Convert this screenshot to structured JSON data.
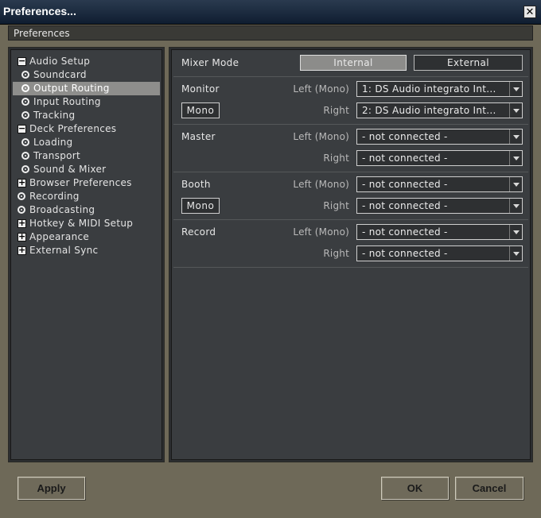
{
  "window": {
    "title": "Preferences...",
    "close_glyph": "✕"
  },
  "header": {
    "title": "Preferences"
  },
  "nav": {
    "items": [
      {
        "label": "Audio Setup",
        "icon": "minus-box",
        "level": 0,
        "selected": false
      },
      {
        "label": "Soundcard",
        "icon": "radio",
        "level": 1,
        "selected": false
      },
      {
        "label": "Output Routing",
        "icon": "radio",
        "level": 1,
        "selected": true
      },
      {
        "label": "Input Routing",
        "icon": "radio",
        "level": 1,
        "selected": false
      },
      {
        "label": "Tracking",
        "icon": "radio",
        "level": 1,
        "selected": false
      },
      {
        "label": "Deck Preferences",
        "icon": "minus-box",
        "level": 0,
        "selected": false
      },
      {
        "label": "Loading",
        "icon": "radio",
        "level": 1,
        "selected": false
      },
      {
        "label": "Transport",
        "icon": "radio",
        "level": 1,
        "selected": false
      },
      {
        "label": "Sound & Mixer",
        "icon": "radio",
        "level": 1,
        "selected": false
      },
      {
        "label": "Browser Preferences",
        "icon": "plus-box",
        "level": 0,
        "selected": false
      },
      {
        "label": "Recording",
        "icon": "radio",
        "level": 0,
        "selected": false
      },
      {
        "label": "Broadcasting",
        "icon": "radio",
        "level": 0,
        "selected": false
      },
      {
        "label": "Hotkey & MIDI Setup",
        "icon": "plus-box",
        "level": 0,
        "selected": false
      },
      {
        "label": "Appearance",
        "icon": "plus-box",
        "level": 0,
        "selected": false
      },
      {
        "label": "External Sync",
        "icon": "plus-box",
        "level": 0,
        "selected": false
      }
    ]
  },
  "routing": {
    "mixer_mode_label": "Mixer Mode",
    "mode_internal": "Internal",
    "mode_external": "External",
    "mode_selected": "Internal",
    "left_mono_label": "Left (Mono)",
    "right_label": "Right",
    "mono_label": "Mono",
    "monitor": {
      "label": "Monitor",
      "left": "1: DS Audio integrato Int...",
      "right": "2: DS Audio integrato Int..."
    },
    "master": {
      "label": "Master",
      "left": "- not connected -",
      "right": "- not connected -"
    },
    "booth": {
      "label": "Booth",
      "left": "- not connected -",
      "right": "- not connected -"
    },
    "record": {
      "label": "Record",
      "left": "- not connected -",
      "right": "- not connected -"
    }
  },
  "buttons": {
    "apply": "Apply",
    "ok": "OK",
    "cancel": "Cancel"
  },
  "colors": {
    "window_bg": "#6e6958",
    "panel_bg": "#3a3d40",
    "selected": "#8e8e8c",
    "titlebar": "#0f1d30"
  }
}
